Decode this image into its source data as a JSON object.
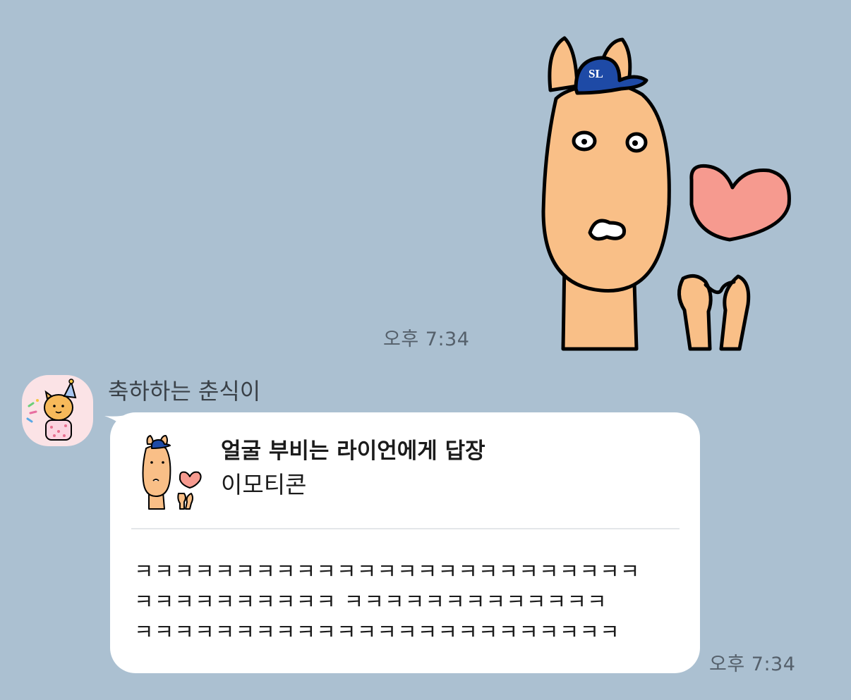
{
  "chat": {
    "sent_time": "오후 7:34",
    "received_time": "오후 7:34",
    "sender_name": "축하하는 춘식이",
    "reply": {
      "title": "얼굴 부비는 라이언에게 답장",
      "subtitle": "이모티콘"
    },
    "message_lines": [
      "ㅋㅋㅋㅋㅋㅋㅋㅋㅋㅋㅋㅋㅋㅋㅋㅋㅋㅋㅋㅋㅋㅋㅋㅋㅋ",
      "ㅋㅋㅋㅋㅋㅋㅋㅋㅋㅋ ㅋㅋㅋㅋㅋㅋㅋㅋㅋㅋㅋㅋㅋ",
      "ㅋㅋㅋㅋㅋㅋㅋㅋㅋㅋㅋㅋㅋㅋㅋㅋㅋㅋㅋㅋㅋㅋㅋㅋ"
    ],
    "sticker_cap_letters": "SL"
  },
  "colors": {
    "background": "#abc0d1",
    "bubble": "#ffffff",
    "time_text": "#55606b",
    "sticker_skin": "#f9bf87",
    "heart": "#f69a8f",
    "cap": "#1e4aa6"
  },
  "icons": {
    "sent_sticker": "horse-in-cap-heart-sticker",
    "avatar": "chunsik-cat-party-hat-avatar",
    "reply_thumbnail": "horse-heart-sticker-thumbnail"
  }
}
